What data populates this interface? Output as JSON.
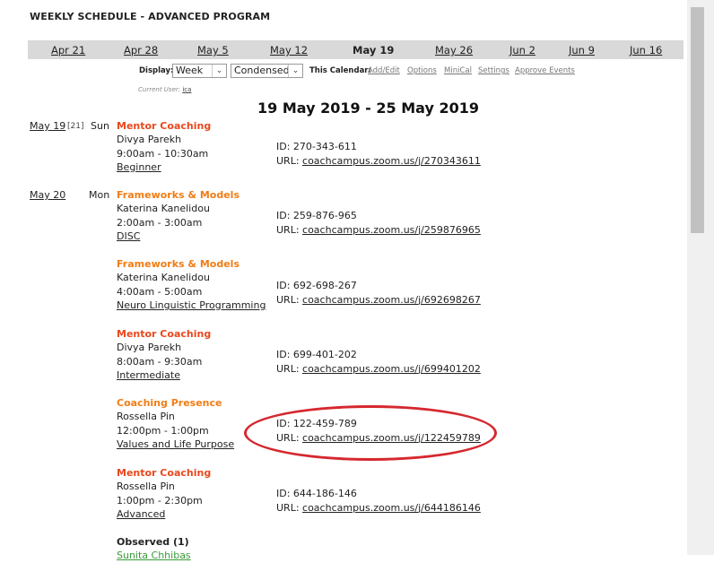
{
  "header": {
    "title": "WEEKLY SCHEDULE - ADVANCED PROGRAM"
  },
  "weeks": [
    "Apr 21",
    "Apr 28",
    "May 5",
    "May 12",
    "May 19",
    "May 26",
    "Jun 2",
    "Jun 9",
    "Jun 16"
  ],
  "current_week": "May 19",
  "toolbar": {
    "display_label": "Display:",
    "view_value": "Week",
    "mode_value": "Condensed",
    "calendar_label": "This Calendar:",
    "links": [
      "Add/Edit",
      "Options",
      "MiniCal",
      "Settings",
      "Approve Events"
    ]
  },
  "user": {
    "label": "Current User:",
    "name": "ica"
  },
  "range_title": "19 May 2019 - 25 May 2019",
  "days": [
    {
      "date": "May 19",
      "count": "[21]",
      "dow": "Sun"
    },
    {
      "date": "May 20",
      "count": "",
      "dow": "Mon"
    }
  ],
  "events": [
    {
      "title": "Mentor Coaching",
      "color": "#e8491d",
      "host": "Divya Parekh",
      "time": "9:00am - 10:30am",
      "category": "Beginner",
      "id": "ID: 270-343-611",
      "url_label": "URL:",
      "url": "coachcampus.zoom.us/j/270343611"
    },
    {
      "title": "Frameworks & Models",
      "color": "#f07d16",
      "host": "Katerina Kanelidou",
      "time": "2:00am - 3:00am",
      "category": "DISC",
      "id": "ID: 259-876-965",
      "url_label": "URL:",
      "url": "coachcampus.zoom.us/j/259876965"
    },
    {
      "title": "Frameworks & Models",
      "color": "#f07d16",
      "host": "Katerina Kanelidou",
      "time": "4:00am - 5:00am",
      "category": "Neuro Linguistic Programming",
      "id": "ID: 692-698-267",
      "url_label": "URL:",
      "url": "coachcampus.zoom.us/j/692698267"
    },
    {
      "title": "Mentor Coaching",
      "color": "#e8491d",
      "host": "Divya Parekh",
      "time": "8:00am - 9:30am",
      "category": "Intermediate",
      "id": "ID: 699-401-202",
      "url_label": "URL:",
      "url": "coachcampus.zoom.us/j/699401202"
    },
    {
      "title": "Coaching Presence",
      "color": "#f07d16",
      "host": "Rossella Pin",
      "time": "12:00pm - 1:00pm",
      "category": "Values and Life Purpose",
      "id": "ID: 122-459-789",
      "url_label": "URL:",
      "url": "coachcampus.zoom.us/j/122459789"
    },
    {
      "title": "Mentor Coaching",
      "color": "#e8491d",
      "host": "Rossella Pin",
      "time": "1:00pm - 2:30pm",
      "category": "Advanced",
      "id": "ID: 644-186-146",
      "url_label": "URL:",
      "url": "coachcampus.zoom.us/j/644186146"
    }
  ],
  "observed": {
    "title": "Observed (1)",
    "partial_name": "Sunita Chhibas",
    "color": "#3a9a3a"
  },
  "highlight": {
    "color": "#d6282f"
  }
}
